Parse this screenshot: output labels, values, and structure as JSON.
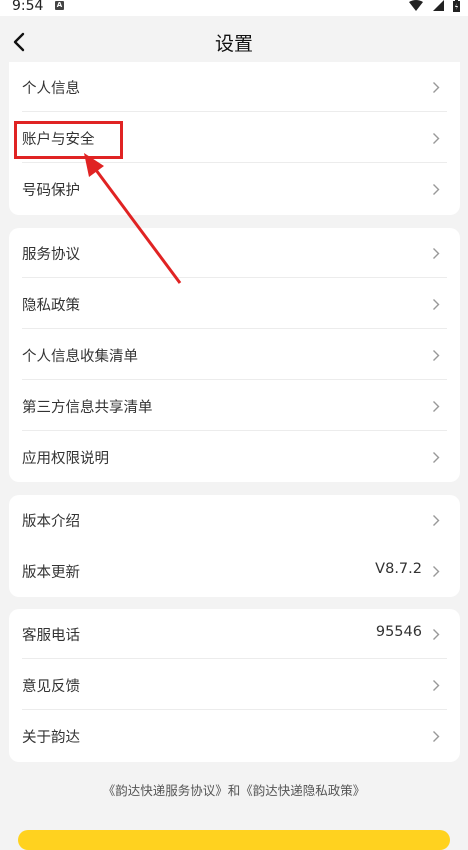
{
  "status_bar": {
    "time": "9:54",
    "a_icon_letter": "A",
    "icons": [
      "wifi-icon",
      "signal-icon",
      "battery-icon"
    ]
  },
  "header": {
    "title": "设置",
    "back_icon": "chevron-left-icon"
  },
  "group1": [
    {
      "label": "个人信息",
      "value": ""
    },
    {
      "label": "账户与安全",
      "value": ""
    },
    {
      "label": "号码保护",
      "value": ""
    }
  ],
  "group2": [
    {
      "label": "服务协议",
      "value": ""
    },
    {
      "label": "隐私政策",
      "value": ""
    },
    {
      "label": "个人信息收集清单",
      "value": ""
    },
    {
      "label": "第三方信息共享清单",
      "value": ""
    },
    {
      "label": "应用权限说明",
      "value": ""
    }
  ],
  "group3": [
    {
      "label": "版本介绍",
      "value": ""
    },
    {
      "label": "版本更新",
      "value": "V8.7.2"
    }
  ],
  "group4": [
    {
      "label": "客服电话",
      "value": "95546"
    },
    {
      "label": "意见反馈",
      "value": ""
    },
    {
      "label": "关于韵达",
      "value": ""
    }
  ],
  "footer": {
    "link1": "《韵达快递服务协议》",
    "conj": "和",
    "link2": "《韵达快递隐私政策》"
  },
  "colors": {
    "accent_yellow": "#ffd21f",
    "annotation_red": "#e02323",
    "background": "#f3f3f3"
  }
}
